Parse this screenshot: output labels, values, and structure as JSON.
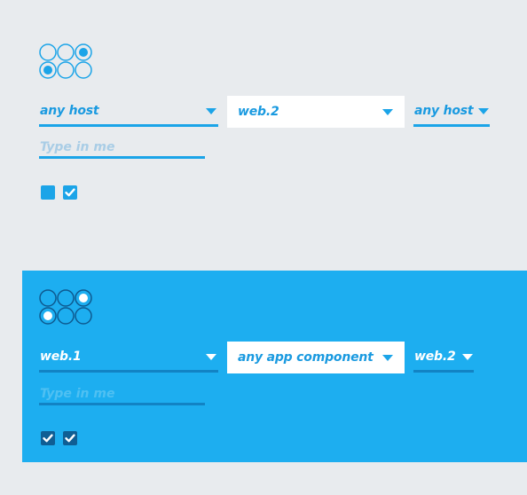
{
  "light_panel": {
    "selectors": [
      {
        "value": "any host",
        "style": "underline"
      },
      {
        "value": "web.2",
        "style": "boxed"
      },
      {
        "value": "any host",
        "style": "underline"
      }
    ],
    "input": {
      "placeholder": "Type in me",
      "value": ""
    },
    "checkboxes": [
      {
        "checked": false
      },
      {
        "checked": true
      }
    ],
    "grid_selected": [
      3,
      4
    ]
  },
  "blue_panel": {
    "selectors": [
      {
        "value": "web.1",
        "style": "underline"
      },
      {
        "value": "any app component",
        "style": "boxed"
      },
      {
        "value": "web.2",
        "style": "underline"
      }
    ],
    "input": {
      "placeholder": "Type in me",
      "value": ""
    },
    "checkboxes": [
      {
        "checked": true
      },
      {
        "checked": true
      }
    ],
    "grid_selected": [
      3,
      4
    ]
  },
  "colors": {
    "accent": "#1ba4e8",
    "page_bg": "#e8ebee",
    "blue_bg": "#1daef0",
    "dark_accent": "#1283c4"
  }
}
